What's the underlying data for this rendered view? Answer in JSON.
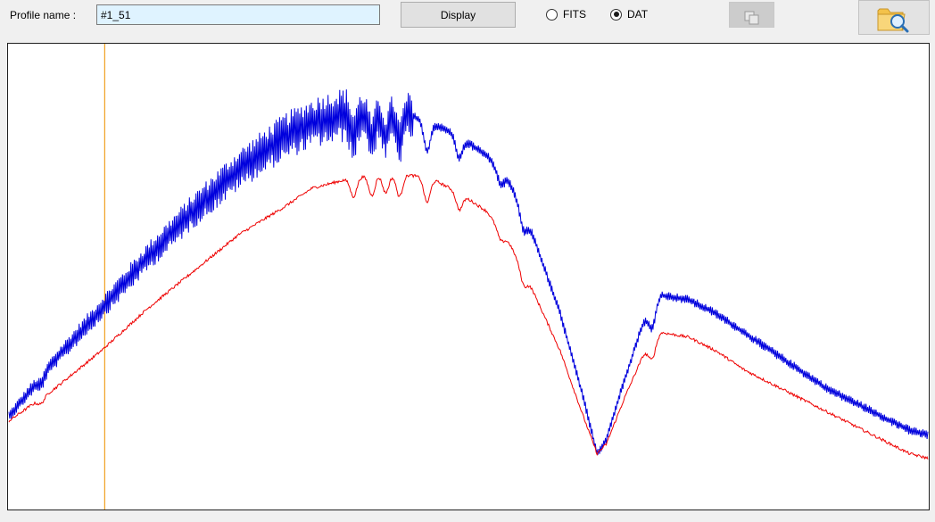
{
  "toolbar": {
    "profile_label": "Profile name :",
    "profile_value": "#1_51",
    "display_label": "Display",
    "format_options": [
      "FITS",
      "DAT"
    ],
    "selected_format": "DAT",
    "copy_icon": "copy-icon",
    "open_icon": "folder-search-icon"
  },
  "colors": {
    "blue_series": "#0000dd",
    "red_series": "#ee0000",
    "cursor": "#f0a020",
    "input_bg": "#dff3ff"
  },
  "chart_data": {
    "type": "line",
    "title": "",
    "xlabel": "",
    "ylabel": "",
    "grid": false,
    "legend": "none",
    "series": [
      {
        "color": "#0000dd",
        "noisy": true,
        "x": [
          0,
          0.05,
          0.1,
          0.15,
          0.2,
          0.25,
          0.3,
          0.33,
          0.37,
          0.4,
          0.43,
          0.46,
          0.49,
          0.52,
          0.545,
          0.57,
          0.6,
          0.625,
          0.64,
          0.65,
          0.67,
          0.69,
          0.71,
          0.74,
          0.77,
          0.8,
          0.83,
          0.86,
          0.89,
          0.92,
          0.95,
          0.98,
          1.0
        ],
        "y": [
          0.2,
          0.32,
          0.43,
          0.54,
          0.64,
          0.73,
          0.8,
          0.83,
          0.85,
          0.85,
          0.85,
          0.83,
          0.8,
          0.76,
          0.7,
          0.59,
          0.42,
          0.24,
          0.12,
          0.15,
          0.28,
          0.4,
          0.46,
          0.45,
          0.42,
          0.38,
          0.34,
          0.3,
          0.26,
          0.23,
          0.2,
          0.17,
          0.16
        ]
      },
      {
        "color": "#ee0000",
        "noisy": false,
        "x": [
          0,
          0.05,
          0.1,
          0.15,
          0.2,
          0.25,
          0.3,
          0.33,
          0.37,
          0.4,
          0.43,
          0.46,
          0.49,
          0.52,
          0.545,
          0.57,
          0.6,
          0.625,
          0.64,
          0.65,
          0.67,
          0.69,
          0.71,
          0.74,
          0.77,
          0.8,
          0.83,
          0.86,
          0.89,
          0.92,
          0.95,
          0.98,
          1.0
        ],
        "y": [
          0.19,
          0.26,
          0.34,
          0.43,
          0.51,
          0.59,
          0.65,
          0.69,
          0.71,
          0.72,
          0.72,
          0.71,
          0.68,
          0.64,
          0.57,
          0.47,
          0.34,
          0.2,
          0.12,
          0.14,
          0.24,
          0.33,
          0.38,
          0.37,
          0.34,
          0.3,
          0.27,
          0.24,
          0.21,
          0.18,
          0.15,
          0.12,
          0.11
        ]
      }
    ],
    "cursor_x": 0.105,
    "dips": [
      {
        "x": 0.035,
        "depth": 0.015
      },
      {
        "x": 0.375,
        "depth": 0.05
      },
      {
        "x": 0.395,
        "depth": 0.055
      },
      {
        "x": 0.41,
        "depth": 0.05
      },
      {
        "x": 0.425,
        "depth": 0.06
      },
      {
        "x": 0.455,
        "depth": 0.065
      },
      {
        "x": 0.49,
        "depth": 0.045
      },
      {
        "x": 0.535,
        "depth": 0.025
      },
      {
        "x": 0.56,
        "depth": 0.035
      },
      {
        "x": 0.7,
        "depth": 0.04
      }
    ]
  }
}
